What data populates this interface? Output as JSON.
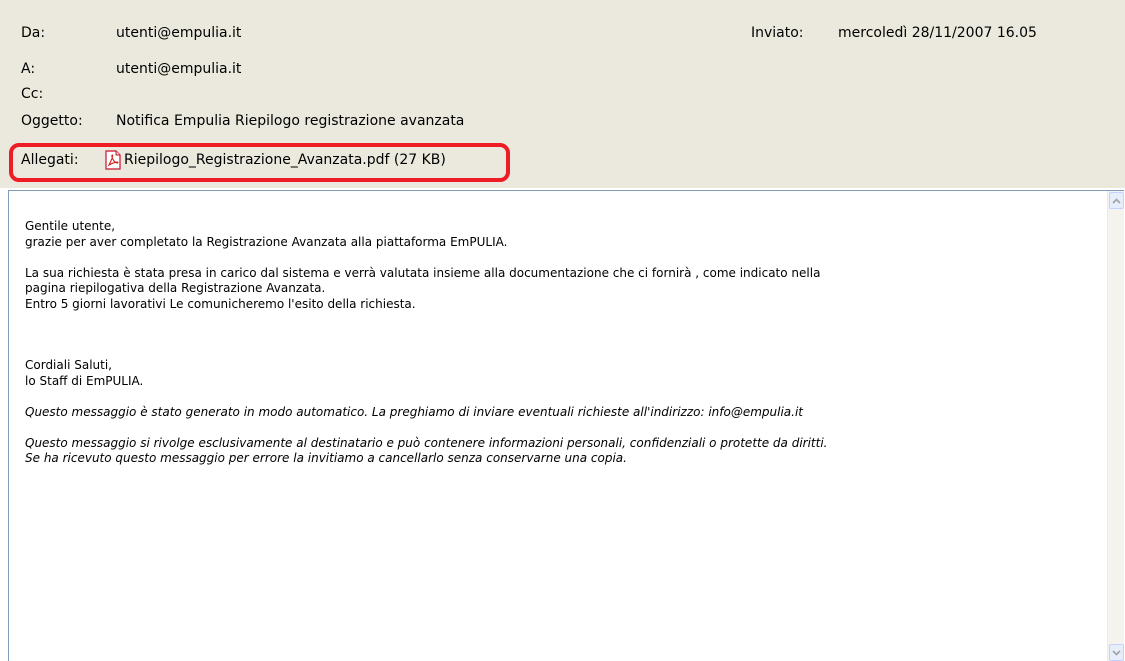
{
  "header": {
    "from_label": "Da:",
    "from_value": "utenti@empulia.it",
    "sent_label": "Inviato:",
    "sent_value": "mercoledì 28/11/2007 16.05",
    "to_label": "A:",
    "to_value": "utenti@empulia.it",
    "cc_label": "Cc:",
    "subject_label": "Oggetto:",
    "subject_value": "Notifica Empulia Riepilogo registrazione avanzata",
    "attachments_label": "Allegati:",
    "attachment_name": "Riepilogo_Registrazione_Avanzata.pdf (27 KB)",
    "highlight_color": "#ee1c25"
  },
  "message": {
    "line1": "Gentile utente,",
    "line2": "grazie per aver completato la Registrazione Avanzata alla piattaforma EmPULIA.",
    "line3": "La sua richiesta è stata presa in carico dal sistema e verrà  valutata insieme alla documentazione che ci fornirà , come indicato nella",
    "line4": "pagina riepilogativa della Registrazione Avanzata.",
    "line5": "Entro 5 giorni lavorativi Le comunicheremo l'esito della richiesta.",
    "line6": "Cordiali Saluti,",
    "line7": "lo Staff di EmPULIA.",
    "line8": "Questo messaggio è stato generato in modo automatico. La preghiamo di inviare eventuali richieste all'indirizzo: info@empulia.it",
    "line9": "Questo messaggio si rivolge esclusivamente al destinatario e può contenere informazioni personali, confidenziali o protette da diritti.",
    "line10": "Se ha ricevuto questo messaggio per errore la invitiamo a cancellarlo senza conservarne una copia."
  },
  "icons": {
    "attachment": "pdf-icon",
    "scroll_up": "scroll-up-arrow-icon",
    "scroll_down": "scroll-down-arrow-icon"
  }
}
